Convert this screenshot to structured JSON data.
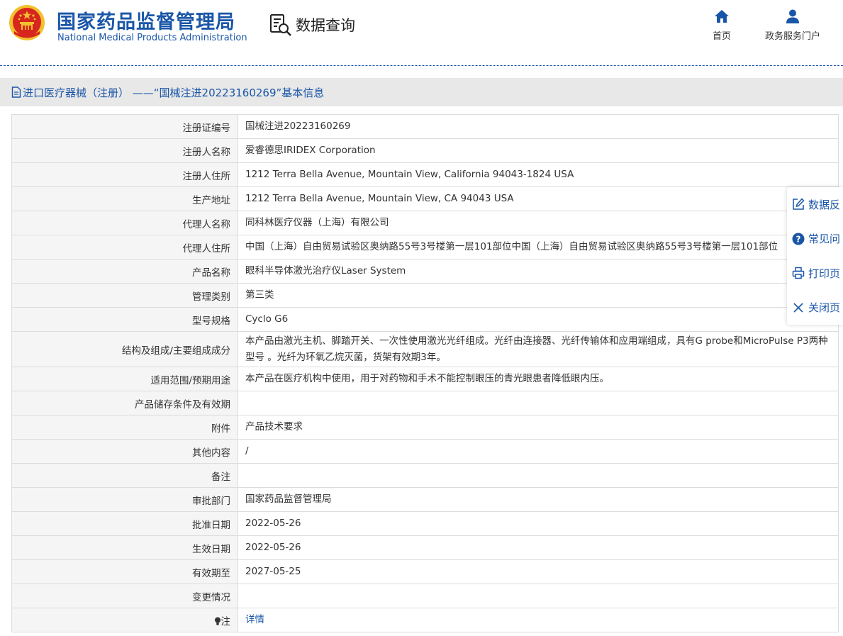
{
  "header": {
    "title_cn": "国家药品监督管理局",
    "title_en": "National Medical Products Administration",
    "query_label": "数据查询",
    "nav": [
      {
        "label": "首页",
        "icon": "home-icon"
      },
      {
        "label": "政务服务门户",
        "icon": "user-icon"
      }
    ]
  },
  "breadcrumb": {
    "text": "进口医疗器械（注册） ——“国械注进20223160269”基本信息"
  },
  "detail": {
    "rows": [
      {
        "label": "注册证编号",
        "value": "国械注进20223160269"
      },
      {
        "label": "注册人名称",
        "value": "爱睿德思IRIDEX Corporation"
      },
      {
        "label": "注册人住所",
        "value": "1212 Terra Bella Avenue, Mountain View, California 94043-1824 USA"
      },
      {
        "label": "生产地址",
        "value": "1212 Terra Bella Avenue, Mountain View, CA 94043 USA"
      },
      {
        "label": "代理人名称",
        "value": "同科林医疗仪器（上海）有限公司"
      },
      {
        "label": "代理人住所",
        "value": "中国（上海）自由贸易试验区奥纳路55号3号楼第一层101部位中国（上海）自由贸易试验区奥纳路55号3号楼第一层101部位"
      },
      {
        "label": "产品名称",
        "value": "眼科半导体激光治疗仪Laser System"
      },
      {
        "label": "管理类别",
        "value": "第三类"
      },
      {
        "label": "型号规格",
        "value": "Cyclo G6"
      },
      {
        "label": "结构及组成/主要组成成分",
        "value": "本产品由激光主机、脚踏开关、一次性使用激光光纤组成。光纤由连接器、光纤传输体和应用端组成，具有G probe和MicroPulse P3两种型号 。光纤为环氧乙烷灭菌，货架有效期3年。"
      },
      {
        "label": "适用范围/预期用途",
        "value": "本产品在医疗机构中使用，用于对药物和手术不能控制眼压的青光眼患者降低眼内压。"
      },
      {
        "label": "产品储存条件及有效期",
        "value": ""
      },
      {
        "label": "附件",
        "value": "产品技术要求"
      },
      {
        "label": "其他内容",
        "value": "/"
      },
      {
        "label": "备注",
        "value": ""
      },
      {
        "label": "审批部门",
        "value": "国家药品监督管理局"
      },
      {
        "label": "批准日期",
        "value": "2022-05-26"
      },
      {
        "label": "生效日期",
        "value": "2022-05-26"
      },
      {
        "label": "有效期至",
        "value": "2027-05-25"
      },
      {
        "label": "变更情况",
        "value": ""
      },
      {
        "label": "注",
        "value": "详情"
      }
    ]
  },
  "side_panel": {
    "items": [
      {
        "label": "数据反",
        "icon": "edit-icon"
      },
      {
        "label": "常见问",
        "icon": "question-icon"
      },
      {
        "label": "打印页",
        "icon": "printer-icon"
      },
      {
        "label": "关闭页",
        "icon": "close-icon"
      }
    ]
  },
  "colors": {
    "brand_blue": "#1a56a8",
    "emblem_red": "#d7261e",
    "emblem_gold": "#f2c12e"
  }
}
